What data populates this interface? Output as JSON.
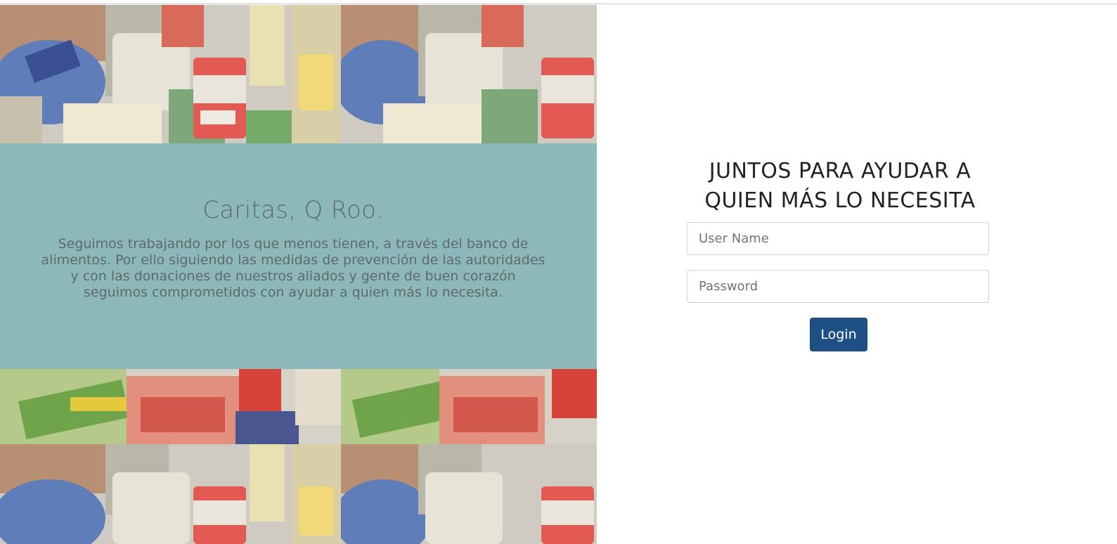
{
  "brand": {
    "title": "Caritas, Q Roo.",
    "description": "Seguimos trabajando por los que menos tienen, a través del banco de alimentos. Por ello siguiendo las medidas de prevención de las autoridades y con las donaciones de nuestros aliados y gente de buen corazón seguimos comprometidos con ayudar a quien más lo necesita."
  },
  "login": {
    "heading": "JUNTOS PARA AYUDAR A QUIEN MÁS LO NECESITA",
    "username_placeholder": "User Name",
    "password_placeholder": "Password",
    "submit_label": "Login"
  },
  "colors": {
    "teal_band": "#8db8b9",
    "primary_button": "#1f5085",
    "brand_text": "#5f6a6c"
  },
  "icons": [
    "food-donation-photo"
  ]
}
